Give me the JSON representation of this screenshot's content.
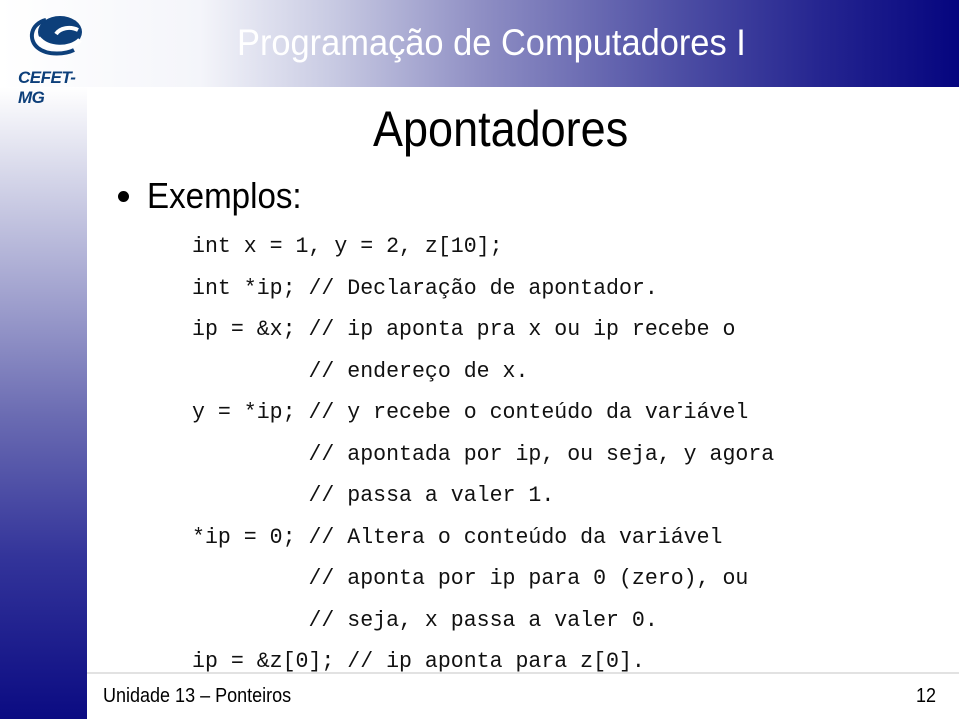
{
  "header": {
    "logo_text": "CEFET-MG",
    "title": "Programação de Computadores I",
    "brand_color": "#05057f",
    "logo_color": "#0d3f7a"
  },
  "slide": {
    "title": "Apontadores",
    "bullet": "Exemplos:",
    "code_lines": [
      "int x = 1, y = 2, z[10];",
      "int *ip; // Declaração de apontador.",
      "ip = &x; // ip aponta pra x ou ip recebe o",
      "         // endereço de x.",
      "y = *ip; // y recebe o conteúdo da variável",
      "         // apontada por ip, ou seja, y agora",
      "         // passa a valer 1.",
      "*ip = 0; // Altera o conteúdo da variável",
      "         // aponta por ip para 0 (zero), ou",
      "         // seja, x passa a valer 0.",
      "ip = &z[0]; // ip aponta para z[0]."
    ]
  },
  "footer": {
    "unit": "Unidade 13 – Ponteiros",
    "page_number": "12"
  }
}
